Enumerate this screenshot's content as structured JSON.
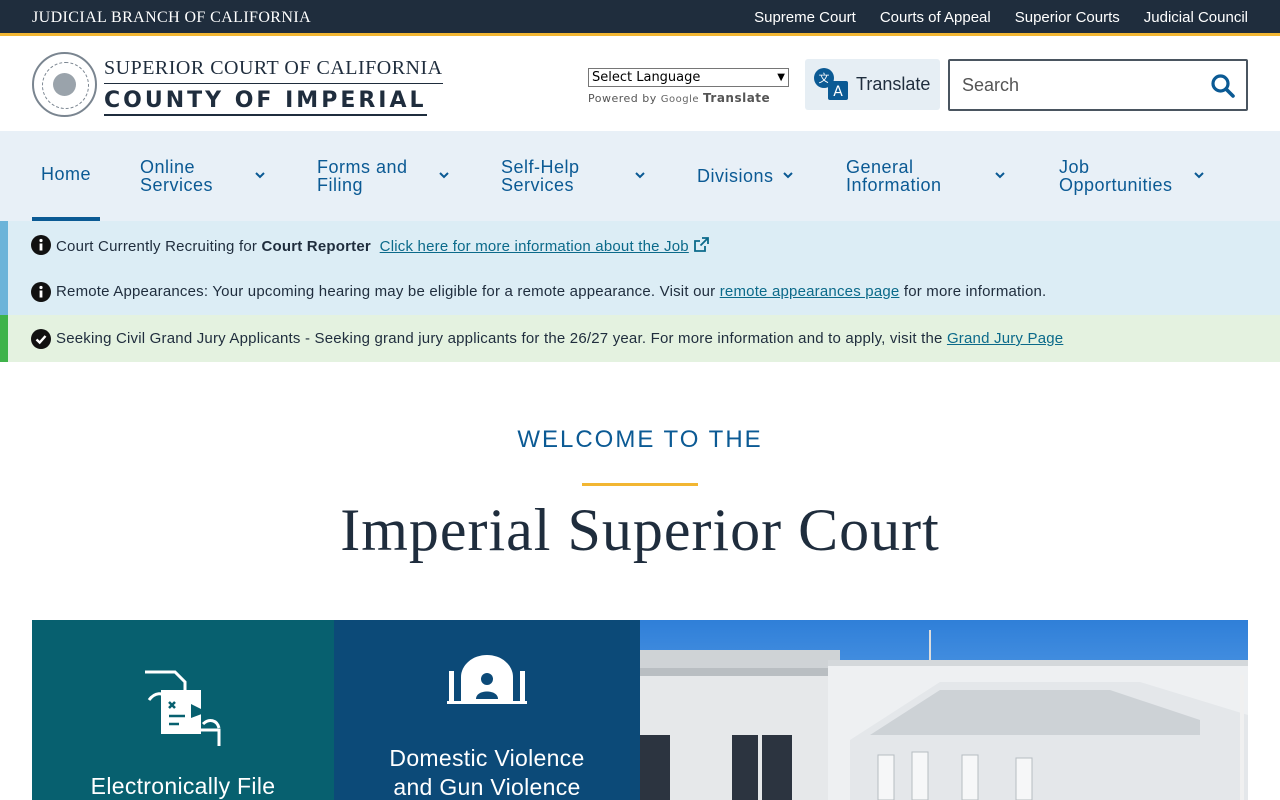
{
  "topbar": {
    "brand": "JUDICIAL BRANCH OF CALIFORNIA",
    "links": [
      "Supreme Court",
      "Courts of Appeal",
      "Superior Courts",
      "Judicial Council"
    ]
  },
  "header": {
    "court_line1": "SUPERIOR COURT OF CALIFORNIA",
    "court_line2": "COUNTY OF IMPERIAL",
    "language_select": "Select Language",
    "powered_by": "Powered by",
    "google": "Google",
    "google_translate": "Translate",
    "translate_button": "Translate",
    "search_placeholder": "Search"
  },
  "nav": {
    "items": [
      {
        "label": "Home",
        "active": true
      },
      {
        "label": "Online Services"
      },
      {
        "label": "Forms and Filing"
      },
      {
        "label": "Self-Help Services"
      },
      {
        "label": "Divisions"
      },
      {
        "label": "General Information"
      },
      {
        "label": "Job Opportunities"
      }
    ]
  },
  "alerts": [
    {
      "icon": "info-icon",
      "prefix": "Court Currently Recruiting for ",
      "bold": "Court Reporter",
      "link": "Click here for more information about the Job"
    },
    {
      "icon": "info-icon",
      "prefix": "Remote Appearances: Your upcoming hearing may be eligible for a remote appearance. Visit our ",
      "link": "remote appearances page",
      "suffix": " for more information."
    },
    {
      "icon": "check-icon",
      "prefix": "Seeking Civil Grand Jury Applicants - Seeking grand jury applicants for the 26/27 year. For more information and to apply, visit the ",
      "link": "Grand Jury Page"
    }
  ],
  "welcome": {
    "small": "WELCOME TO THE",
    "big": "Imperial Superior Court"
  },
  "tiles": [
    {
      "label": "Electronically File"
    },
    {
      "label_line1": "Domestic Violence",
      "label_line2": "and Gun Violence"
    }
  ],
  "colors": {
    "navy": "#1f2d3d",
    "accent_gold": "#f2b632",
    "link_blue": "#0b5a94",
    "teal_tile": "#07606f",
    "blue_tile": "#0c4a78"
  }
}
